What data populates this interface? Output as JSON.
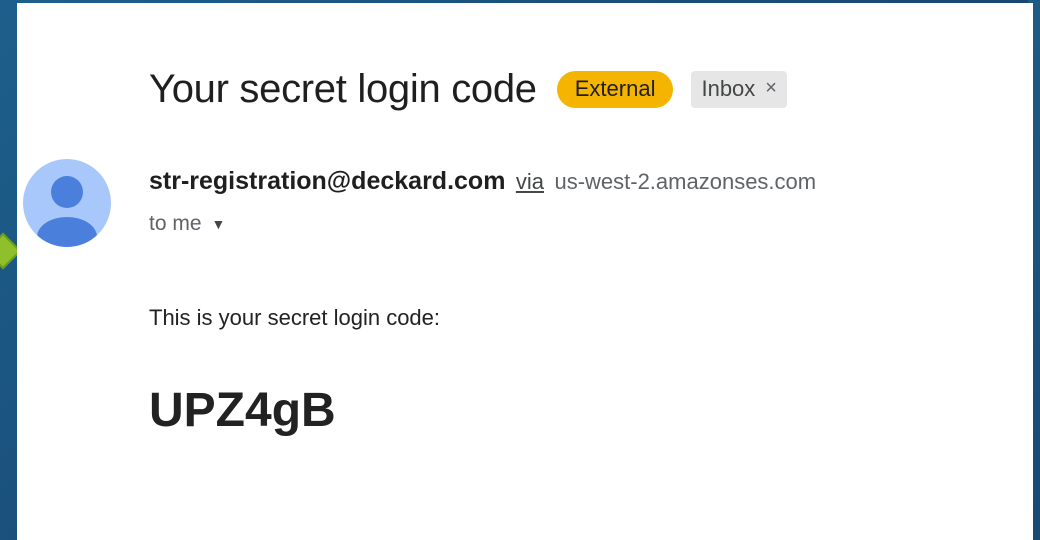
{
  "email": {
    "subject": "Your secret login code",
    "labels": {
      "external": "External",
      "inbox": "Inbox",
      "inbox_remove": "×"
    },
    "sender": {
      "email": "str-registration@deckard.com",
      "via_label": "via",
      "via_domain": "us-west-2.amazonses.com",
      "avatar_icon": "person-icon"
    },
    "recipient": {
      "text": "to me",
      "dropdown_icon": "caret-down-icon",
      "caret": "▼"
    },
    "body": {
      "intro": "This is your secret login code:",
      "code": "UPZ4gB"
    }
  },
  "colors": {
    "external_badge": "#f5b400",
    "inbox_badge": "#e6e6e6",
    "avatar_bg": "#a8c7fa",
    "avatar_figure": "#4a7fdc",
    "marker": "#8fbf2a"
  }
}
